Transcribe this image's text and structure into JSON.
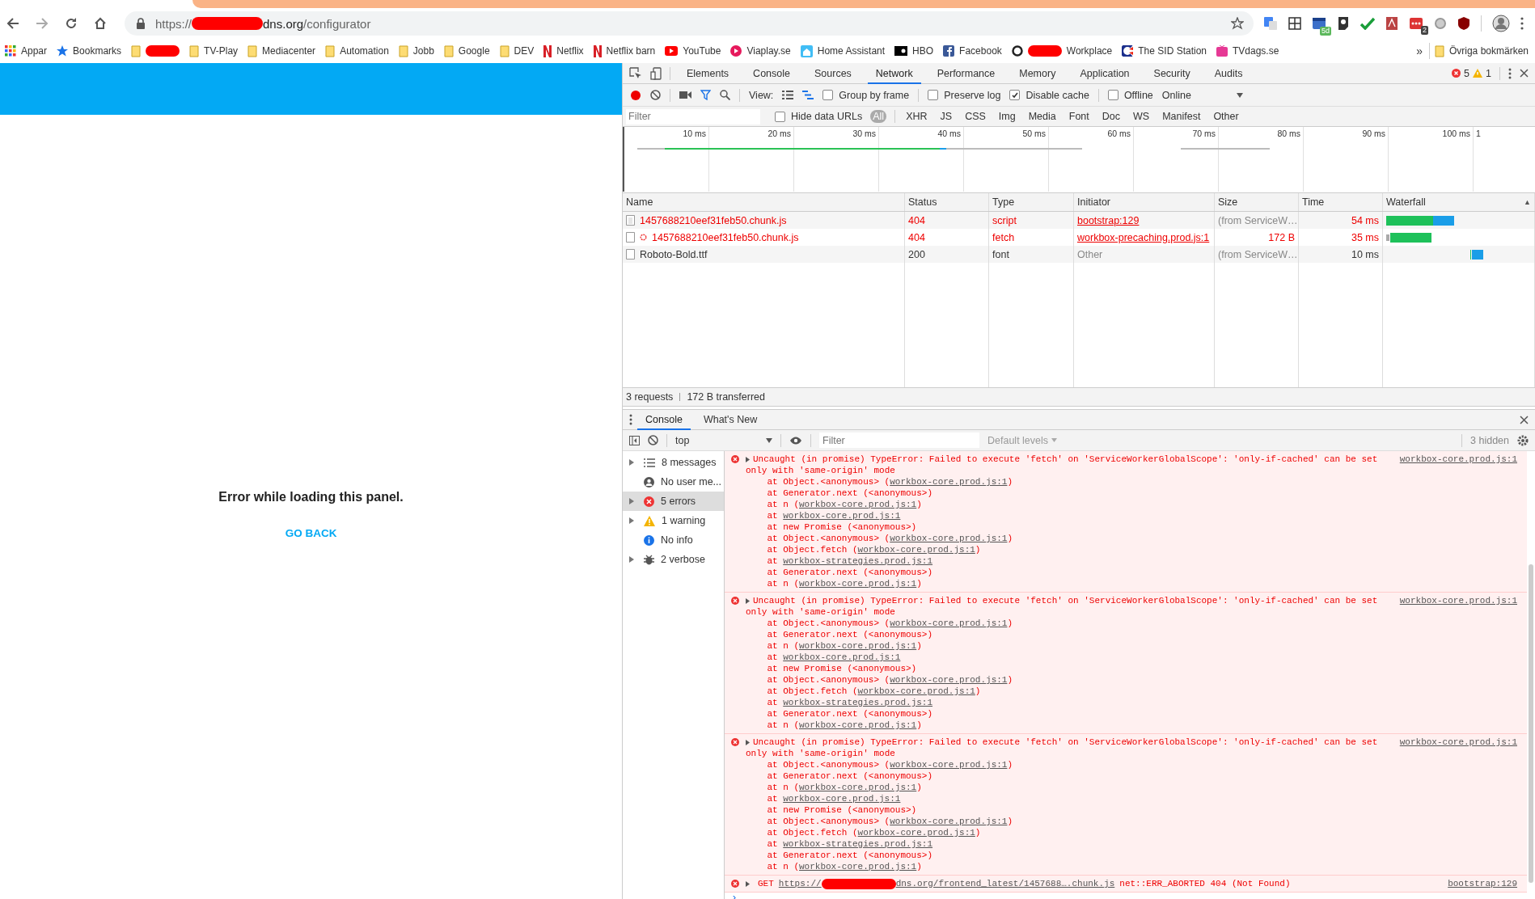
{
  "browser": {
    "url": {
      "scheme": "https://",
      "host_suffix": "dns.org",
      "path": "/configurator",
      "redacted": true
    },
    "extensions": [
      {
        "kind": "translate"
      },
      {
        "kind": "grid"
      },
      {
        "kind": "calendar",
        "badge": "5d"
      },
      {
        "kind": "bulb"
      },
      {
        "kind": "check"
      },
      {
        "kind": "pdf"
      },
      {
        "kind": "dots",
        "badge": "2"
      },
      {
        "kind": "circle"
      },
      {
        "kind": "shield"
      }
    ],
    "bookmarks": [
      {
        "kind": "apps",
        "label": "Appar"
      },
      {
        "kind": "star",
        "label": "Bookmarks"
      },
      {
        "kind": "folder",
        "redacted": true
      },
      {
        "kind": "folder",
        "label": "TV-Play"
      },
      {
        "kind": "folder",
        "label": "Mediacenter"
      },
      {
        "kind": "folder",
        "label": "Automation"
      },
      {
        "kind": "folder",
        "label": "Jobb"
      },
      {
        "kind": "folder",
        "label": "Google"
      },
      {
        "kind": "folder",
        "label": "DEV"
      },
      {
        "kind": "netflix",
        "label": "Netflix"
      },
      {
        "kind": "netflix",
        "label": "Netflix barn"
      },
      {
        "kind": "youtube",
        "label": "YouTube"
      },
      {
        "kind": "viaplay",
        "label": "Viaplay.se"
      },
      {
        "kind": "home",
        "label": "Home Assistant"
      },
      {
        "kind": "hbo",
        "label": "HBO"
      },
      {
        "kind": "facebook",
        "label": "Facebook"
      },
      {
        "kind": "workplace",
        "label": "Workplace",
        "redacted": true
      },
      {
        "kind": "sid",
        "label": "The SID Station"
      },
      {
        "kind": "tv",
        "label": "TVdags.se"
      }
    ],
    "more": "»",
    "other_bookmarks": "Övriga bokmärken"
  },
  "page": {
    "message": "Error while loading this panel.",
    "action": "GO BACK"
  },
  "devtools": {
    "tabs": [
      {
        "label": "Elements",
        "selected": false
      },
      {
        "label": "Console",
        "selected": false
      },
      {
        "label": "Sources",
        "selected": false
      },
      {
        "label": "Network",
        "selected": true
      },
      {
        "label": "Performance",
        "selected": false
      },
      {
        "label": "Memory",
        "selected": false
      },
      {
        "label": "Application",
        "selected": false
      },
      {
        "label": "Security",
        "selected": false
      },
      {
        "label": "Audits",
        "selected": false
      }
    ],
    "error_count": "5",
    "warning_count": "1",
    "toolbar": {
      "view_label": "View:",
      "group_by_frame": {
        "label": "Group by frame",
        "checked": false
      },
      "preserve_log": {
        "label": "Preserve log",
        "checked": false
      },
      "disable_cache": {
        "label": "Disable cache",
        "checked": true
      },
      "offline": {
        "label": "Offline",
        "checked": false
      },
      "throttling": "Online"
    },
    "filter": {
      "placeholder": "Filter",
      "hide_data_urls": {
        "label": "Hide data URLs",
        "checked": false
      },
      "types": [
        {
          "label": "All",
          "selected": true
        },
        {
          "label": "XHR",
          "selected": false
        },
        {
          "label": "JS",
          "selected": false
        },
        {
          "label": "CSS",
          "selected": false
        },
        {
          "label": "Img",
          "selected": false
        },
        {
          "label": "Media",
          "selected": false
        },
        {
          "label": "Font",
          "selected": false
        },
        {
          "label": "Doc",
          "selected": false
        },
        {
          "label": "WS",
          "selected": false
        },
        {
          "label": "Manifest",
          "selected": false
        },
        {
          "label": "Other",
          "selected": false
        }
      ]
    },
    "timeline_ticks": [
      "10 ms",
      "20 ms",
      "30 ms",
      "40 ms",
      "50 ms",
      "60 ms",
      "70 ms",
      "80 ms",
      "90 ms",
      "100 ms",
      "1"
    ],
    "table": {
      "columns": [
        "Name",
        "Status",
        "Type",
        "Initiator",
        "Size",
        "Time",
        "Waterfall"
      ],
      "sort_indicator": "▲",
      "rows": [
        {
          "kind": "script",
          "name": "1457688210eef31feb50.chunk.js",
          "status": "404",
          "resource_type": "script",
          "initiator": "bootstrap:129",
          "initiator_link": true,
          "size": "(from ServiceW…",
          "time": "54 ms",
          "error": true
        },
        {
          "kind": "gear",
          "name": "1457688210eef31feb50.chunk.js",
          "status": "404",
          "resource_type": "fetch",
          "initiator": "workbox-precaching.prod.js:1",
          "initiator_link": true,
          "size": "172 B",
          "time": "35 ms",
          "error": true
        },
        {
          "kind": "file",
          "name": "Roboto-Bold.ttf",
          "status": "200",
          "resource_type": "font",
          "initiator": "Other",
          "initiator_link": false,
          "size": "(from ServiceW…",
          "time": "10 ms",
          "error": false
        }
      ]
    },
    "summary": {
      "requests": "3 requests",
      "transferred": "172 B transferred"
    },
    "console": {
      "drawer_tabs": [
        {
          "label": "Console",
          "selected": true
        },
        {
          "label": "What's New",
          "selected": false
        }
      ],
      "context": "top",
      "filter_placeholder": "Filter",
      "levels": "Default levels",
      "hidden": "3 hidden",
      "sidebar": [
        {
          "kind": "list",
          "label": "8 messages",
          "expandable": true,
          "selected": false
        },
        {
          "kind": "user",
          "label": "No user me...",
          "expandable": false,
          "selected": false
        },
        {
          "kind": "error",
          "label": "5 errors",
          "expandable": true,
          "selected": true
        },
        {
          "kind": "warning",
          "label": "1 warning",
          "expandable": true,
          "selected": false
        },
        {
          "kind": "info",
          "label": "No info",
          "expandable": false,
          "selected": false
        },
        {
          "kind": "verbose",
          "label": "2 verbose",
          "expandable": true,
          "selected": false
        }
      ],
      "messages": [
        {
          "kind": "exception",
          "text": "Uncaught (in promise) TypeError: Failed to execute 'fetch' on 'ServiceWorkerGlobalScope': 'only-if-cached' can be set only with 'same-origin' mode",
          "source": "workbox-core.prod.js:1",
          "stack": [
            {
              "before": "at Object.<anonymous> (",
              "link": "workbox-core.prod.js:1",
              "after": ")"
            },
            {
              "before": "at Generator.next (<anonymous>)"
            },
            {
              "before": "at n (",
              "link": "workbox-core.prod.js:1",
              "after": ")"
            },
            {
              "before": "at ",
              "link": "workbox-core.prod.js:1"
            },
            {
              "before": "at new Promise (<anonymous>)"
            },
            {
              "before": "at Object.<anonymous> (",
              "link": "workbox-core.prod.js:1",
              "after": ")"
            },
            {
              "before": "at Object.fetch (",
              "link": "workbox-core.prod.js:1",
              "after": ")"
            },
            {
              "before": "at ",
              "link": "workbox-strategies.prod.js:1"
            },
            {
              "before": "at Generator.next (<anonymous>)"
            },
            {
              "before": "at n (",
              "link": "workbox-core.prod.js:1",
              "after": ")"
            }
          ]
        },
        {
          "kind": "exception",
          "text": "Uncaught (in promise) TypeError: Failed to execute 'fetch' on 'ServiceWorkerGlobalScope': 'only-if-cached' can be set only with 'same-origin' mode",
          "source": "workbox-core.prod.js:1",
          "stack": [
            {
              "before": "at Object.<anonymous> (",
              "link": "workbox-core.prod.js:1",
              "after": ")"
            },
            {
              "before": "at Generator.next (<anonymous>)"
            },
            {
              "before": "at n (",
              "link": "workbox-core.prod.js:1",
              "after": ")"
            },
            {
              "before": "at ",
              "link": "workbox-core.prod.js:1"
            },
            {
              "before": "at new Promise (<anonymous>)"
            },
            {
              "before": "at Object.<anonymous> (",
              "link": "workbox-core.prod.js:1",
              "after": ")"
            },
            {
              "before": "at Object.fetch (",
              "link": "workbox-core.prod.js:1",
              "after": ")"
            },
            {
              "before": "at ",
              "link": "workbox-strategies.prod.js:1"
            },
            {
              "before": "at Generator.next (<anonymous>)"
            },
            {
              "before": "at n (",
              "link": "workbox-core.prod.js:1",
              "after": ")"
            }
          ]
        },
        {
          "kind": "exception",
          "text": "Uncaught (in promise) TypeError: Failed to execute 'fetch' on 'ServiceWorkerGlobalScope': 'only-if-cached' can be set only with 'same-origin' mode",
          "source": "workbox-core.prod.js:1",
          "stack": [
            {
              "before": "at Object.<anonymous> (",
              "link": "workbox-core.prod.js:1",
              "after": ")"
            },
            {
              "before": "at Generator.next (<anonymous>)"
            },
            {
              "before": "at n (",
              "link": "workbox-core.prod.js:1",
              "after": ")"
            },
            {
              "before": "at ",
              "link": "workbox-core.prod.js:1"
            },
            {
              "before": "at new Promise (<anonymous>)"
            },
            {
              "before": "at Object.<anonymous> (",
              "link": "workbox-core.prod.js:1",
              "after": ")"
            },
            {
              "before": "at Object.fetch (",
              "link": "workbox-core.prod.js:1",
              "after": ")"
            },
            {
              "before": "at ",
              "link": "workbox-strategies.prod.js:1"
            },
            {
              "before": "at Generator.next (<anonymous>)"
            },
            {
              "before": "at n (",
              "link": "workbox-core.prod.js:1",
              "after": ")"
            }
          ]
        },
        {
          "kind": "network",
          "method": "GET",
          "url_start": "https://",
          "url_end": "dns.org/frontend_latest/1457688….chunk.js",
          "redacted": true,
          "text": "net::ERR_ABORTED 404 (Not Found)",
          "source": "bootstrap:129"
        }
      ],
      "prompt": "›"
    }
  }
}
